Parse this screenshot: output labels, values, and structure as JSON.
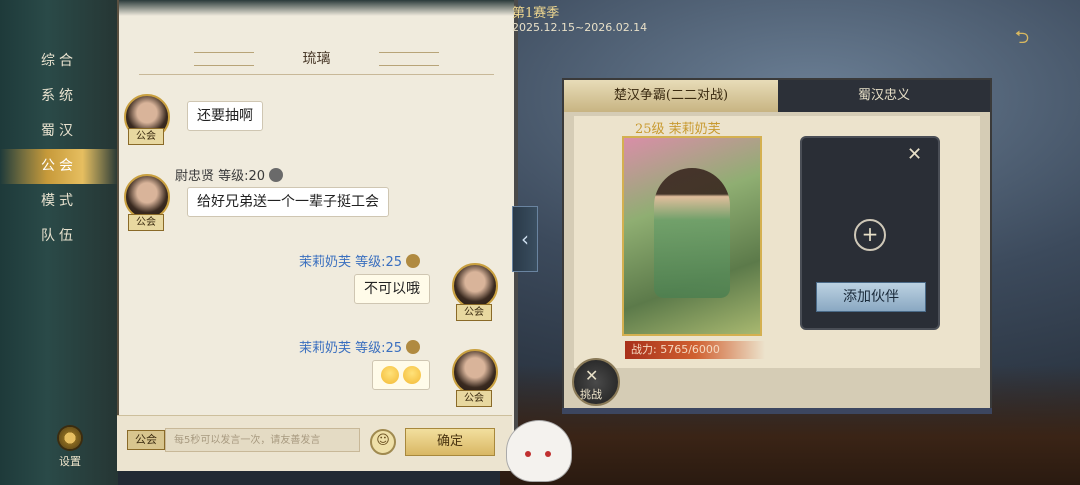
{
  "nav": {
    "items": [
      "综合",
      "系统",
      "蜀汉",
      "公会",
      "模式",
      "队伍"
    ],
    "active_index": 3,
    "settings_label": "设置"
  },
  "chat": {
    "title": "琉璃",
    "messages": [
      {
        "side": "other",
        "name": "",
        "level": "",
        "text": "还要抽啊",
        "badge": "公会"
      },
      {
        "side": "other",
        "name": "尉忠贤",
        "level": "等级:20",
        "text": "给好兄弟送一个一辈子挺工会",
        "badge": "公会"
      },
      {
        "side": "mine",
        "name": "茉莉奶芙",
        "level": "等级:25",
        "text": "不可以哦",
        "badge": "公会"
      },
      {
        "side": "mine",
        "name": "茉莉奶芙",
        "level": "等级:25",
        "text": "",
        "emoji": [
          "smile-emoji",
          "smile-emoji"
        ],
        "badge": "公会"
      }
    ],
    "input": {
      "channel": "公会",
      "placeholder": "每5秒可以发言一次，请友善发言",
      "confirm_label": "确定"
    }
  },
  "season": {
    "title": "第1赛季",
    "dates": "2025.12.15~2026.02.14"
  },
  "battle": {
    "tabs": [
      "楚汉争霸(二二对战)",
      "蜀汉忠义"
    ],
    "active_tab": 0,
    "hero": {
      "level_name": "25级 茉莉奶芙",
      "power_label": "战力:",
      "power": "5765/6000"
    },
    "add_partner_label": "添加伙伴",
    "challenge_label": "挑战"
  },
  "colors": {
    "accent": "#d9b764",
    "chat_bg": "#f0ebdd",
    "mine_name": "#3a6fbf"
  }
}
